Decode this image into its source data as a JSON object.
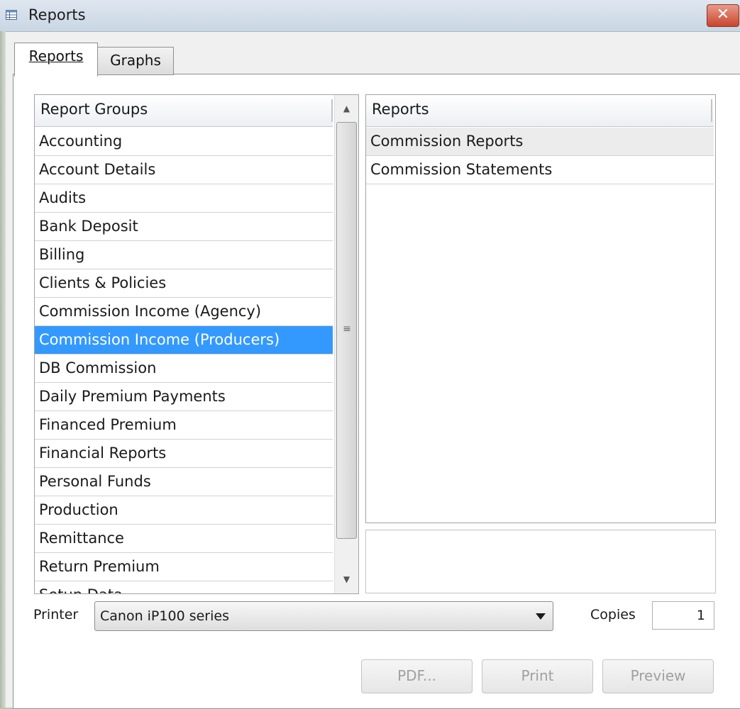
{
  "window": {
    "title": "Reports",
    "close_glyph": "✕"
  },
  "tabs": [
    {
      "label": "Reports",
      "active": true
    },
    {
      "label": "Graphs",
      "active": false
    }
  ],
  "report_groups": {
    "header": "Report Groups",
    "selected": "Commission Income (Producers)",
    "items": [
      "Accounting",
      "Account Details",
      "Audits",
      "Bank Deposit",
      "Billing",
      "Clients & Policies",
      "Commission Income (Agency)",
      "Commission Income (Producers)",
      "DB Commission",
      "Daily Premium Payments",
      "Financed Premium",
      "Financial Reports",
      "Personal Funds",
      "Production",
      "Remittance",
      "Return Premium",
      "Setup Data"
    ]
  },
  "reports": {
    "header": "Reports",
    "items": [
      "Commission Reports",
      "Commission Statements"
    ]
  },
  "printer": {
    "label": "Printer",
    "value": "Canon iP100 series"
  },
  "copies": {
    "label": "Copies",
    "value": "1"
  },
  "buttons": {
    "pdf": "PDF...",
    "print": "Print",
    "preview": "Preview"
  },
  "colors": {
    "selection": "#3399ff",
    "close": "#c9452e"
  }
}
